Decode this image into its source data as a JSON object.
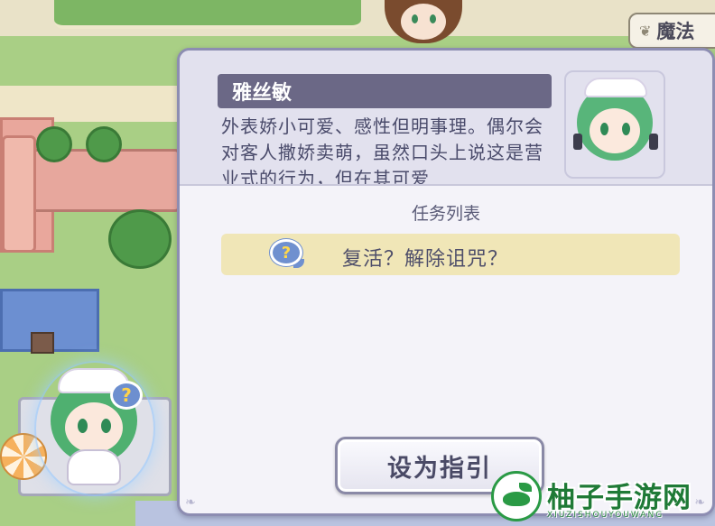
{
  "map": {
    "magic_tab_label": "魔法"
  },
  "npc_panel": {
    "character_name": "雅丝敏",
    "description": "外表娇小可爱、感性但明事理。偶尔会对客人撒娇卖萌，虽然口头上说这是营业式的行为，但在其可爱",
    "quest_section_title": "任务列表",
    "quests": [
      {
        "label": "复活？解除诅咒？",
        "icon": "question-bubble-icon"
      }
    ],
    "guide_button_label": "设为指引"
  },
  "watermark": {
    "title": "柚子手游网",
    "subtitle": "XIUZISHOUYOUWANG"
  },
  "colors": {
    "name_bar": "#6b6886",
    "quest_highlight": "#f0e6b7",
    "panel_border": "#8d8db2",
    "watermark_green": "#1f7a36"
  }
}
